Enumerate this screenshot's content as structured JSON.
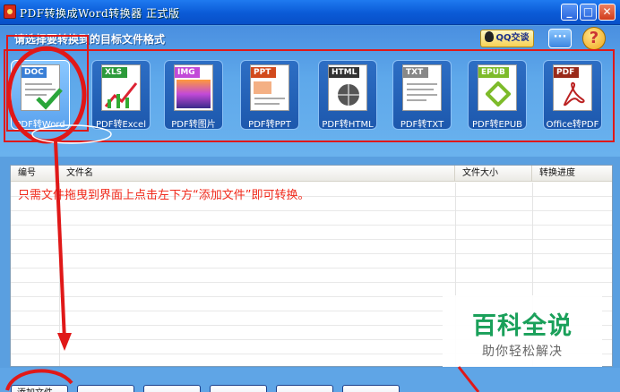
{
  "window": {
    "title": "PDF转换成Word转换器 正式版",
    "min_glyph": "_",
    "max_glyph": "□",
    "close_glyph": "✕"
  },
  "header": {
    "prompt": "请选择要转换到的目标文件格式",
    "qq_label": "QQ交谈",
    "chat_glyph": "···",
    "help_glyph": "?"
  },
  "formats": [
    {
      "band": "DOC",
      "label": "PDF转Word",
      "color": "#3a7fd6",
      "selected": true
    },
    {
      "band": "XLS",
      "label": "PDF转Excel",
      "color": "#2c9a3a",
      "selected": false
    },
    {
      "band": "IMG",
      "label": "PDF转图片",
      "color": "#c24ad8",
      "selected": false
    },
    {
      "band": "PPT",
      "label": "PDF转PPT",
      "color": "#d24a1c",
      "selected": false
    },
    {
      "band": "HTML",
      "label": "PDF转HTML",
      "color": "#333333",
      "selected": false
    },
    {
      "band": "TXT",
      "label": "PDF转TXT",
      "color": "#888888",
      "selected": false
    },
    {
      "band": "EPUB",
      "label": "PDF转EPUB",
      "color": "#7dbb2a",
      "selected": false
    },
    {
      "band": "PDF",
      "label": "Office转PDF",
      "color": "#9a2a1a",
      "selected": false
    }
  ],
  "file_list": {
    "columns": [
      "编号",
      "文件名",
      "文件大小",
      "转换进度"
    ],
    "hint": "只需文件拖曳到界面上点击左下方“添加文件”即可转换。"
  },
  "bottom_buttons": [
    "添加文件",
    "",
    "",
    "",
    "",
    ""
  ],
  "watermark": {
    "title": "百科全说",
    "subtitle": "助你轻松解决"
  },
  "colors": {
    "accent": "#e01818",
    "titlebar": "#0a5ad6",
    "hint_text": "#f0281a",
    "watermark_green": "#1aa05a"
  }
}
